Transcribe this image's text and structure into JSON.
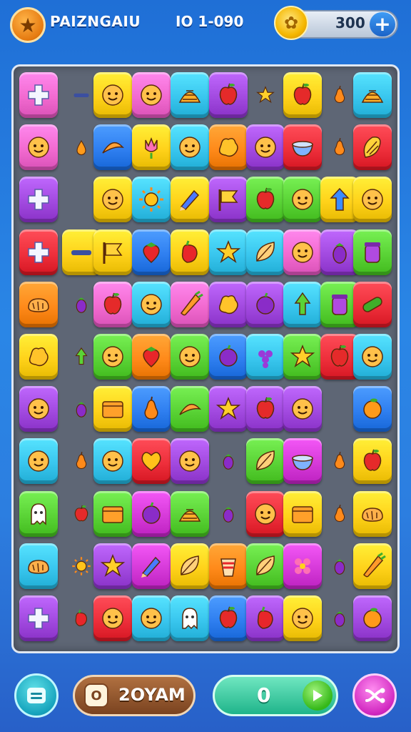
{
  "header": {
    "title": "PAIZNGAIU",
    "level": "IO 1-090",
    "coins": "300",
    "plus_label": "+"
  },
  "footer": {
    "timer": "2OYAM",
    "score": "0"
  },
  "palette": {
    "pink": "#f26ad0",
    "yellow": "#ffd21a",
    "cyan": "#39c6ee",
    "purple": "#a24ae0",
    "orange": "#ff8a1a",
    "red": "#ee2f3b",
    "green": "#5ad336",
    "blue": "#2f7ff0",
    "magenta": "#d63ad9"
  },
  "grid": {
    "rows": [
      [
        "pink:cross",
        "loose:dash",
        "yellow:face",
        "pink:face",
        "cyan:shell",
        "purple:apple",
        "loose:star",
        "yellow:apple",
        "loose:pear",
        "cyan:shell"
      ],
      [
        "pink:face",
        "loose:drop",
        "blue:croissant",
        "yellow:tulip",
        "cyan:face",
        "orange:blob",
        "purple:face",
        "red:bowl",
        "loose:pear",
        "red:corn"
      ],
      [
        "purple:cross",
        "empty",
        "yellow:face",
        "cyan:sun",
        "yellow:pencil",
        "purple:flag",
        "green:apple",
        "green:face",
        "yellow:arrow",
        "yellow:face"
      ],
      [
        "red:cross",
        "yellow:dash",
        "yellow:flag",
        "blue:strawberry",
        "yellow:pepper",
        "cyan:star",
        "cyan:leaf",
        "pink:face",
        "purple:eggplant",
        "green:jar"
      ],
      [
        "orange:bread",
        "loose:eggplant",
        "pink:apple",
        "cyan:face",
        "pink:carrot",
        "purple:blob",
        "purple:plum",
        "cyan:tree",
        "green:jar",
        "red:cucumber"
      ],
      [
        "yellow:blob",
        "loose:tree",
        "green:face",
        "orange:strawberry",
        "green:face",
        "blue:plum",
        "cyan:grapes",
        "green:star",
        "red:apple",
        "cyan:face"
      ],
      [
        "purple:face",
        "loose:eggplant",
        "yellow:box",
        "blue:pear",
        "green:croissant",
        "purple:star",
        "purple:apple",
        "purple:face",
        "empty",
        "blue:orange"
      ],
      [
        "cyan:face",
        "loose:pear",
        "cyan:face",
        "red:heart",
        "purple:face",
        "loose:eggplant",
        "green:leaf",
        "magenta:bowl",
        "loose:pear",
        "yellow:apple"
      ],
      [
        "green:ghost",
        "loose:apple",
        "green:box",
        "magenta:plum",
        "green:shell",
        "loose:eggplant",
        "red:face",
        "yellow:box",
        "loose:pear",
        "yellow:bread"
      ],
      [
        "cyan:bread",
        "loose:sun",
        "purple:star",
        "magenta:pencil",
        "yellow:leaf",
        "orange:cup",
        "green:leaf",
        "magenta:flower",
        "loose:eggplant",
        "yellow:carrot"
      ],
      [
        "purple:cross",
        "loose:pepper",
        "red:face",
        "cyan:face",
        "cyan:ghost",
        "blue:apple",
        "purple:pepper",
        "yellow:face",
        "loose:eggplant",
        "purple:orange"
      ]
    ]
  }
}
